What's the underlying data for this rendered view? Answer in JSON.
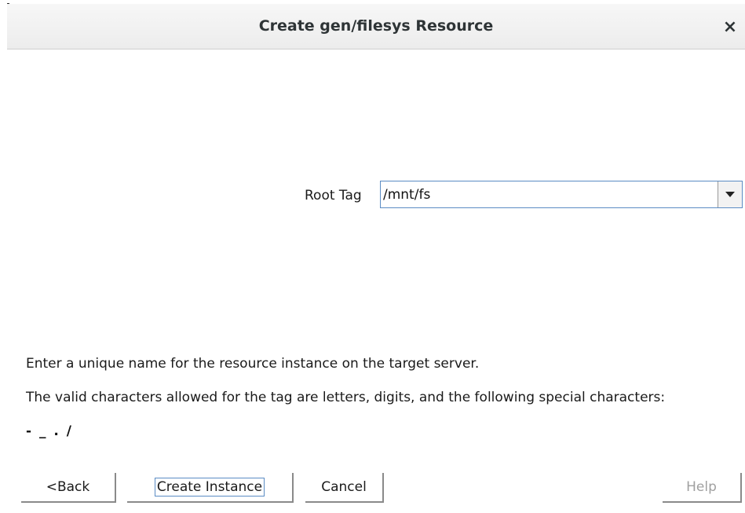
{
  "dialog": {
    "title": "Create gen/filesys Resource",
    "close_glyph": "×"
  },
  "form": {
    "root_tag_label": "Root Tag",
    "root_tag_value": "/mnt/fs"
  },
  "help": {
    "line1": "Enter a unique name for the resource instance on the target server.",
    "line2": "The valid characters allowed for the tag are letters, digits, and the following special characters:",
    "special_chars": "- _ . /"
  },
  "buttons": {
    "back": "<Back",
    "create_instance": "Create Instance",
    "cancel": "Cancel",
    "help": "Help"
  },
  "icons": {
    "close": "close-icon",
    "dropdown": "chevron-down-icon"
  },
  "colors": {
    "focus_border": "#5b8cc4",
    "disabled_text": "#a0a0a0"
  }
}
